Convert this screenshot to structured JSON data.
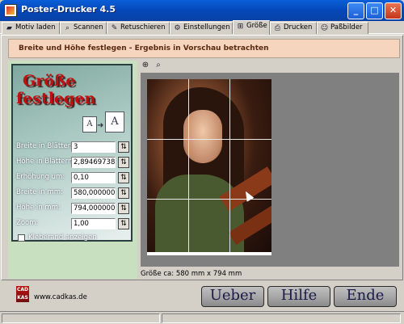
{
  "window": {
    "title": "Poster-Drucker 4.5"
  },
  "tabs": [
    {
      "label": "Motiv laden",
      "icon": "folder-icon"
    },
    {
      "label": "Scannen",
      "icon": "scanner-icon"
    },
    {
      "label": "Retuschieren",
      "icon": "brush-icon"
    },
    {
      "label": "Einstellungen",
      "icon": "settings-icon"
    },
    {
      "label": "Größe",
      "icon": "size-icon",
      "active": true
    },
    {
      "label": "Drucken",
      "icon": "printer-icon"
    },
    {
      "label": "Paßbilder",
      "icon": "passport-icon"
    }
  ],
  "instruction": "Breite und Höhe festlegen - Ergebnis in Vorschau betrachten",
  "wizard": {
    "title_line1": "Größe",
    "title_line2": "festlegen",
    "icon_small": "A",
    "icon_big": "A",
    "fields": [
      {
        "label": "Breite in Blättern:",
        "value": "3"
      },
      {
        "label": "Höhe in Blättern:",
        "value": "2,89469738"
      },
      {
        "label": "Erhöhung um:",
        "value": "0,10"
      },
      {
        "label": "Breite in mm:",
        "value": "580,0000000"
      },
      {
        "label": "Höhe in mm:",
        "value": "794,0000000"
      },
      {
        "label": "Zoom:",
        "value": "1,00"
      }
    ],
    "checkbox_label": "Kleberand anzeigen",
    "checkbox_checked": false
  },
  "preview": {
    "size_text": "Größe ca: 580 mm x 794 mm"
  },
  "footer": {
    "logo_text": "CAD KAS",
    "url": "www.cadkas.de",
    "buttons": {
      "about": "Ueber",
      "help": "Hilfe",
      "end": "Ende"
    }
  }
}
